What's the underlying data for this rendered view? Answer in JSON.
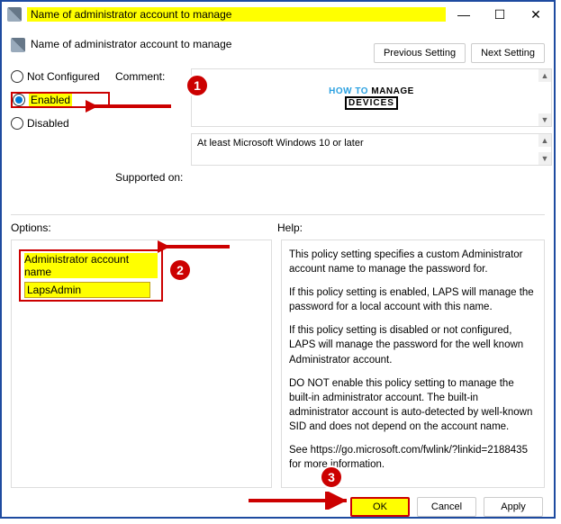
{
  "window": {
    "title": "Name of administrator account to manage",
    "minimize": "—",
    "maximize": "☐",
    "close": "✕"
  },
  "header": {
    "title": "Name of administrator account to manage",
    "previous": "Previous Setting",
    "next": "Next Setting"
  },
  "state": {
    "not_configured": "Not Configured",
    "enabled": "Enabled",
    "disabled": "Disabled",
    "selected": "enabled"
  },
  "meta": {
    "comment_label": "Comment:",
    "supported_label": "Supported on:",
    "supported_value": "At least Microsoft Windows 10 or later"
  },
  "brand": {
    "how_to": "HOW TO",
    "manage": "MANAGE",
    "devices": "DEVICES"
  },
  "panes": {
    "options_label": "Options:",
    "help_label": "Help:"
  },
  "options": {
    "field_label": "Administrator account name",
    "field_value": "LapsAdmin"
  },
  "help": {
    "p1": "This policy setting specifies a custom Administrator account name to manage the password for.",
    "p2": "If this policy setting is enabled, LAPS will manage the password for a local account with this name.",
    "p3": "If this policy setting is disabled or not configured, LAPS will manage the password for the well known Administrator account.",
    "p4": "DO NOT enable this policy setting to manage the built-in administrator account. The built-in administrator account is auto-detected by well-known SID and does not depend on the account name.",
    "p5": "See https://go.microsoft.com/fwlink/?linkid=2188435 for more information."
  },
  "actions": {
    "ok": "OK",
    "cancel": "Cancel",
    "apply": "Apply"
  },
  "callouts": {
    "one": "1",
    "two": "2",
    "three": "3"
  }
}
